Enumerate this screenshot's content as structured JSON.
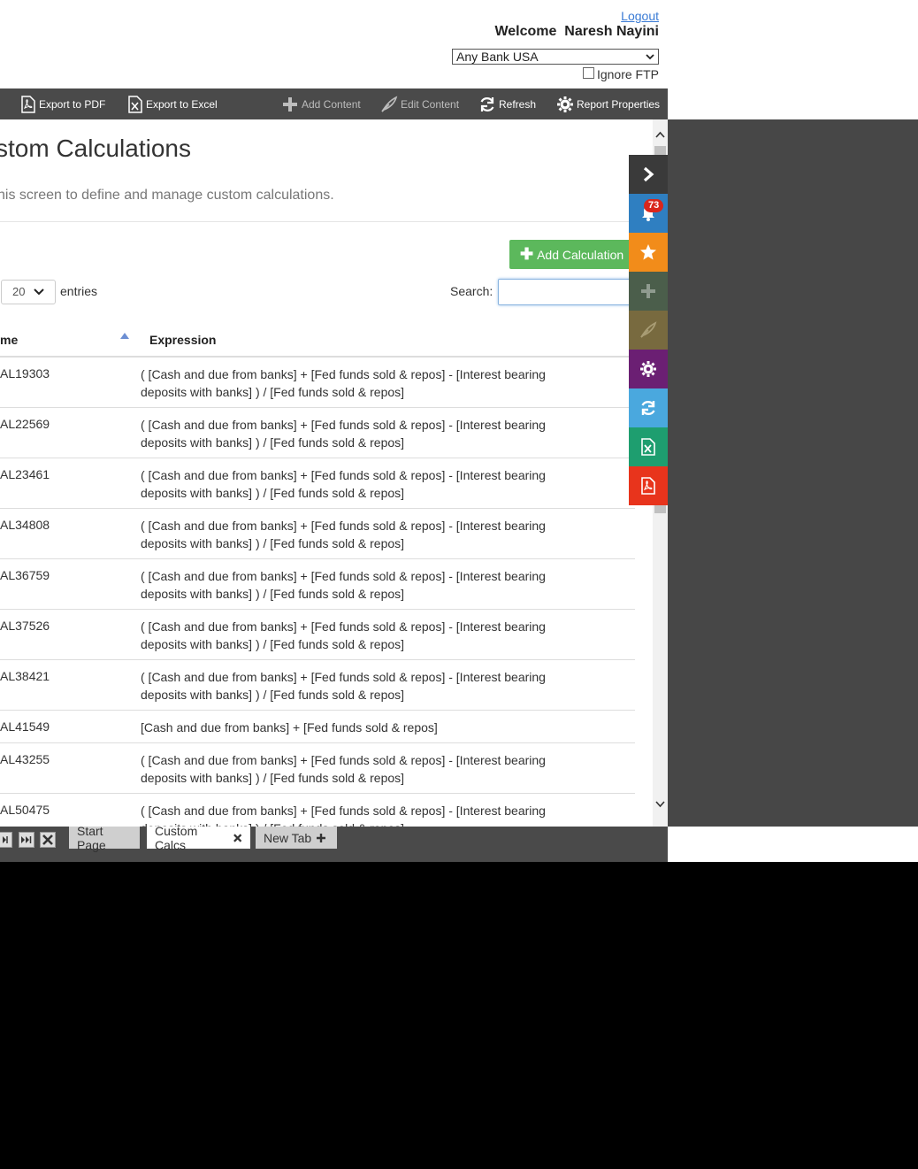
{
  "header": {
    "logout_label": "Logout",
    "welcome_text": "Welcome  Naresh Nayini",
    "bank_selected": "Any Bank USA",
    "ignore_ftp_label": "Ignore FTP"
  },
  "toolbar": {
    "export_pdf": "Export to PDF",
    "export_excel": "Export to Excel",
    "add_content": "Add Content",
    "edit_content": "Edit Content",
    "refresh": "Refresh",
    "report_properties": "Report Properties"
  },
  "page": {
    "title": "stom Calculations",
    "subtitle": "his screen to define and manage custom calculations.",
    "add_button": "Add Calculation",
    "length_value": "20",
    "entries_label": "entries",
    "search_label": "Search:"
  },
  "table": {
    "headers": {
      "name": "me",
      "expression": "Expression"
    },
    "rows": [
      {
        "name": "AL19303",
        "expr": "( [Cash and due from banks] + [Fed funds sold & repos] - [Interest bearing deposits with banks] ) / [Fed funds sold & repos]"
      },
      {
        "name": "AL22569",
        "expr": "( [Cash and due from banks] + [Fed funds sold & repos] - [Interest bearing deposits with banks] ) / [Fed funds sold & repos]"
      },
      {
        "name": "AL23461",
        "expr": "( [Cash and due from banks] + [Fed funds sold & repos] - [Interest bearing deposits with banks] ) / [Fed funds sold & repos]"
      },
      {
        "name": "AL34808",
        "expr": "( [Cash and due from banks] + [Fed funds sold & repos] - [Interest bearing deposits with banks] ) / [Fed funds sold & repos]"
      },
      {
        "name": "AL36759",
        "expr": "( [Cash and due from banks] + [Fed funds sold & repos] - [Interest bearing deposits with banks] ) / [Fed funds sold & repos]"
      },
      {
        "name": "AL37526",
        "expr": "( [Cash and due from banks] + [Fed funds sold & repos] - [Interest bearing deposits with banks] ) / [Fed funds sold & repos]"
      },
      {
        "name": "AL38421",
        "expr": "( [Cash and due from banks] + [Fed funds sold & repos] - [Interest bearing deposits with banks] ) / [Fed funds sold & repos]"
      },
      {
        "name": "AL41549",
        "expr": "[Cash and due from banks] + [Fed funds sold & repos]"
      },
      {
        "name": "AL43255",
        "expr": "( [Cash and due from banks] + [Fed funds sold & repos] - [Interest bearing deposits with banks] ) / [Fed funds sold & repos]"
      },
      {
        "name": "AL50475",
        "expr": "( [Cash and due from banks] + [Fed funds sold & repos] - [Interest bearing deposits with banks] ) / [Fed funds sold & repos]"
      }
    ]
  },
  "side_panel": {
    "notification_count": "73",
    "colors": {
      "collapse": "#3a3a3a",
      "notifications": "#2f7fc1",
      "favorites": "#f28c1a",
      "add": "#4b5e4b",
      "edit": "#786a3f",
      "settings": "#6b1f73",
      "refresh": "#4aa8de",
      "excel": "#1e9e6f",
      "pdf": "#e8341c"
    }
  },
  "tabs": [
    {
      "label": "Start Page"
    },
    {
      "label": "Custom Calcs"
    },
    {
      "label": "New Tab"
    }
  ]
}
